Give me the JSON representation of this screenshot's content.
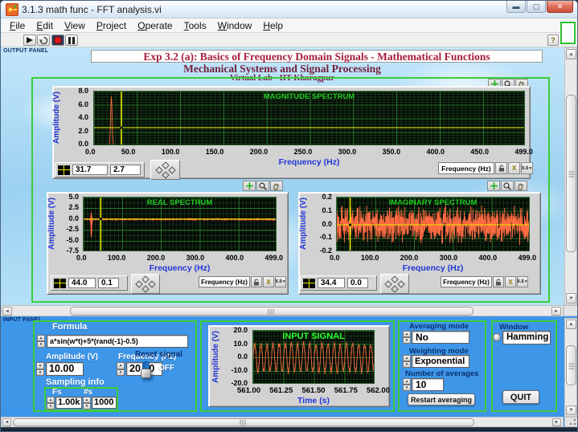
{
  "window": {
    "title": "3.1.3 math func - FFT analysis.vi"
  },
  "menu": {
    "items": [
      "File",
      "Edit",
      "View",
      "Project",
      "Operate",
      "Tools",
      "Window",
      "Help"
    ]
  },
  "toolbar": {
    "icons": [
      "run-arrow",
      "run-continuous",
      "abort",
      "pause",
      "context-help"
    ]
  },
  "panels": {
    "output_label": "OUTPUT PANEL",
    "input_label": "INPUT PANEL"
  },
  "header": {
    "line1": "Exp 3.2 (a): Basics of Frequency Domain Signals - Mathematical Functions",
    "line2": "Mechanical Systems and Signal Processing",
    "line3": "Virtual Lab  - IIT Kharagpur"
  },
  "scale_legend": {
    "label": "Frequency (Hz)",
    "format": "8.8"
  },
  "colors": {
    "accent_green": "#3bcd3b",
    "panel_blue": "#3d96e8",
    "signal": "#ff6b42",
    "cursor": "#e8e800",
    "axis_label_blue": "#2135d8",
    "plot_title_green": "#22cd22",
    "grid_minor": "#1a451d",
    "grid_major": "#2f8f33",
    "title_maroon": "#a81d3c"
  },
  "inputs": {
    "formula_label": "Formula",
    "formula_value": "a*sin(w*t)+5*(rand(-1)-0.5)",
    "amplitude_label": "Amplitude (V)",
    "amplitude_value": "10.00",
    "frequency_label": "Frequency (Hz)",
    "frequency_value": "20.00",
    "reset_label": "Reset signal",
    "reset_state": "OFF",
    "sampling_label": "Sampling info",
    "fs_label": "Fs",
    "fs_value": "1.00k",
    "ns_label": "#s",
    "ns_value": "1000"
  },
  "controls": {
    "averaging_label": "Averaging mode",
    "averaging_value": "No",
    "weighting_label": "Weighting mode",
    "weighting_value": "Exponential",
    "navg_label": "Number of averages",
    "navg_value": "10",
    "restart_button": "Restart averaging",
    "window_label": "Window",
    "window_value": "Hamming",
    "quit_button": "QUIT"
  },
  "chart_data": [
    {
      "id": "magnitude",
      "type": "line",
      "title": "MAGNITUDE SPECTRUM",
      "xlabel": "Frequency (Hz)",
      "ylabel": "Amplitude (V)",
      "xlim": [
        0,
        499
      ],
      "ylim": [
        0,
        8
      ],
      "xticks": [
        "0.0",
        "50.0",
        "100.0",
        "150.0",
        "200.0",
        "250.0",
        "300.0",
        "350.0",
        "400.0",
        "450.0",
        "499.0"
      ],
      "yticks": [
        "8.0",
        "6.0",
        "4.0",
        "2.0",
        "0.0"
      ],
      "minor_x": 5,
      "minor_y": 0.4,
      "seed": 7,
      "gen": {
        "kind": "peak",
        "f0": 20,
        "peak": 7.2,
        "width": 0.9,
        "floor": 0.12
      },
      "cursor": {
        "x": 31.7,
        "y": 2.7,
        "x_label": "31.7",
        "y_label": "2.7"
      }
    },
    {
      "id": "real",
      "type": "line",
      "title": "REAL SPECTRUM",
      "xlabel": "Frequency (Hz)",
      "ylabel": "Amplitude (V)",
      "xlim": [
        0,
        499
      ],
      "ylim": [
        -7.5,
        5
      ],
      "xticks": [
        "0.0",
        "100.0",
        "200.0",
        "300.0",
        "400.0",
        "499.0"
      ],
      "yticks": [
        "5.0",
        "2.5",
        "0.0",
        "-2.5",
        "-5.0",
        "-7.5"
      ],
      "minor_x": 10,
      "minor_y": 1.25,
      "seed": 13,
      "gen": {
        "kind": "realspec",
        "f0": 20,
        "up": 3.2,
        "down": -7.1,
        "floor": 0.12
      },
      "cursor": {
        "x": 44.0,
        "y": 0.1,
        "x_label": "44.0",
        "y_label": "0.1"
      }
    },
    {
      "id": "imaginary",
      "type": "line",
      "title": "IMAGINARY SPECTRUM",
      "xlabel": "Frequency (Hz)",
      "ylabel": "Amplitude (V)",
      "xlim": [
        0,
        499
      ],
      "ylim": [
        -0.2,
        0.2
      ],
      "xticks": [
        "0.0",
        "100.0",
        "200.0",
        "300.0",
        "400.0",
        "499.0"
      ],
      "yticks": [
        "0.2",
        "0.1",
        "0.0",
        "-0.1",
        "-0.2"
      ],
      "minor_x": 10,
      "minor_y": 0.04,
      "seed": 99,
      "gen": {
        "kind": "noise",
        "amp": 0.155
      },
      "cursor": {
        "x": 34.4,
        "y": 0.0,
        "x_label": "34.4",
        "y_label": "0.0"
      }
    },
    {
      "id": "input_signal",
      "type": "line",
      "title": "INPUT SIGNAL",
      "xlabel": "Time (s)",
      "ylabel": "Amplitude (V)",
      "xlim": [
        561,
        562
      ],
      "ylim": [
        -20,
        20
      ],
      "xticks": [
        "561.00",
        "561.25",
        "561.50",
        "561.75",
        "562.00"
      ],
      "yticks": [
        "20.0",
        "10.0",
        "0.0",
        "-10.0",
        "-20.0"
      ],
      "minor_x": 0.025,
      "minor_y": 4,
      "seed": 5,
      "gen": {
        "kind": "sine",
        "freq": 20,
        "amp": 10.3,
        "noise": 1.8
      }
    }
  ]
}
